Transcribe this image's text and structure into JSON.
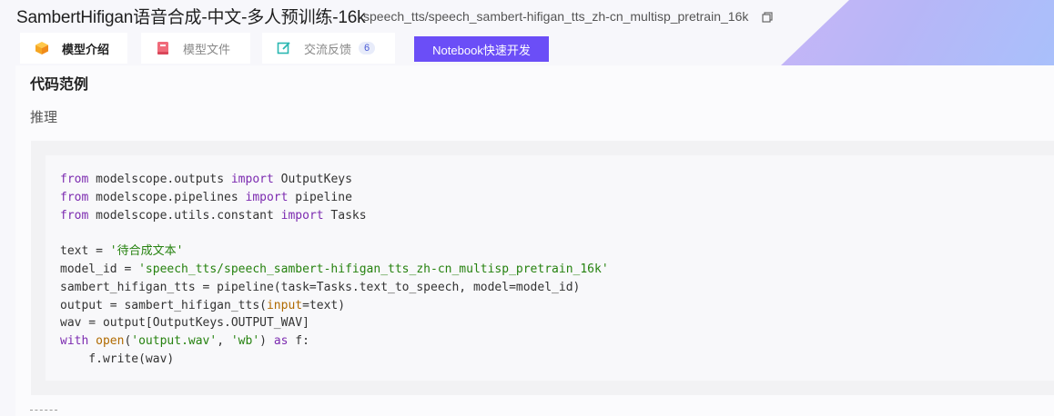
{
  "header": {
    "title": "SambertHifigan语音合成-中文-多人预训练-16k",
    "model_id": "speech_tts/speech_sambert-hifigan_tts_zh-cn_multisp_pretrain_16k",
    "tabs": [
      {
        "label": "模型介绍",
        "icon": "cube-icon",
        "active": true
      },
      {
        "label": "模型文件",
        "icon": "book-icon",
        "active": false
      },
      {
        "label": "交流反馈",
        "icon": "edit-icon",
        "active": false,
        "badge": "6"
      }
    ],
    "notebook_button": "Notebook快速开发"
  },
  "content": {
    "section_title": "代码范例",
    "subsection_title": "推理",
    "code": {
      "lines": [
        [
          [
            "kw",
            "from"
          ],
          [
            "p",
            " modelscope.outputs "
          ],
          [
            "kw",
            "import"
          ],
          [
            "p",
            " OutputKeys"
          ]
        ],
        [
          [
            "kw",
            "from"
          ],
          [
            "p",
            " modelscope.pipelines "
          ],
          [
            "kw",
            "import"
          ],
          [
            "p",
            " pipeline"
          ]
        ],
        [
          [
            "kw",
            "from"
          ],
          [
            "p",
            " modelscope.utils.constant "
          ],
          [
            "kw",
            "import"
          ],
          [
            "p",
            " Tasks"
          ]
        ],
        [],
        [
          [
            "p",
            "text = "
          ],
          [
            "st",
            "'待合成文本'"
          ]
        ],
        [
          [
            "p",
            "model_id = "
          ],
          [
            "st",
            "'speech_tts/speech_sambert-hifigan_tts_zh-cn_multisp_pretrain_16k'"
          ]
        ],
        [
          [
            "p",
            "sambert_hifigan_tts = pipeline(task=Tasks.text_to_speech, model=model_id)"
          ]
        ],
        [
          [
            "p",
            "output = sambert_hifigan_tts("
          ],
          [
            "bi",
            "input"
          ],
          [
            "p",
            "=text)"
          ]
        ],
        [
          [
            "p",
            "wav = output[OutputKeys.OUTPUT_WAV]"
          ]
        ],
        [
          [
            "kw",
            "with"
          ],
          [
            "p",
            " "
          ],
          [
            "bi",
            "open"
          ],
          [
            "p",
            "("
          ],
          [
            "st",
            "'output.wav'"
          ],
          [
            "p",
            ", "
          ],
          [
            "st",
            "'wb'"
          ],
          [
            "p",
            ") "
          ],
          [
            "kw",
            "as"
          ],
          [
            "p",
            " f:"
          ]
        ],
        [
          [
            "p",
            "    f.write(wav)"
          ]
        ]
      ]
    }
  },
  "colors": {
    "accent": "#6b4ef7",
    "keyword": "#7c2bb0",
    "string": "#26820f",
    "builtin": "#b06a00"
  }
}
